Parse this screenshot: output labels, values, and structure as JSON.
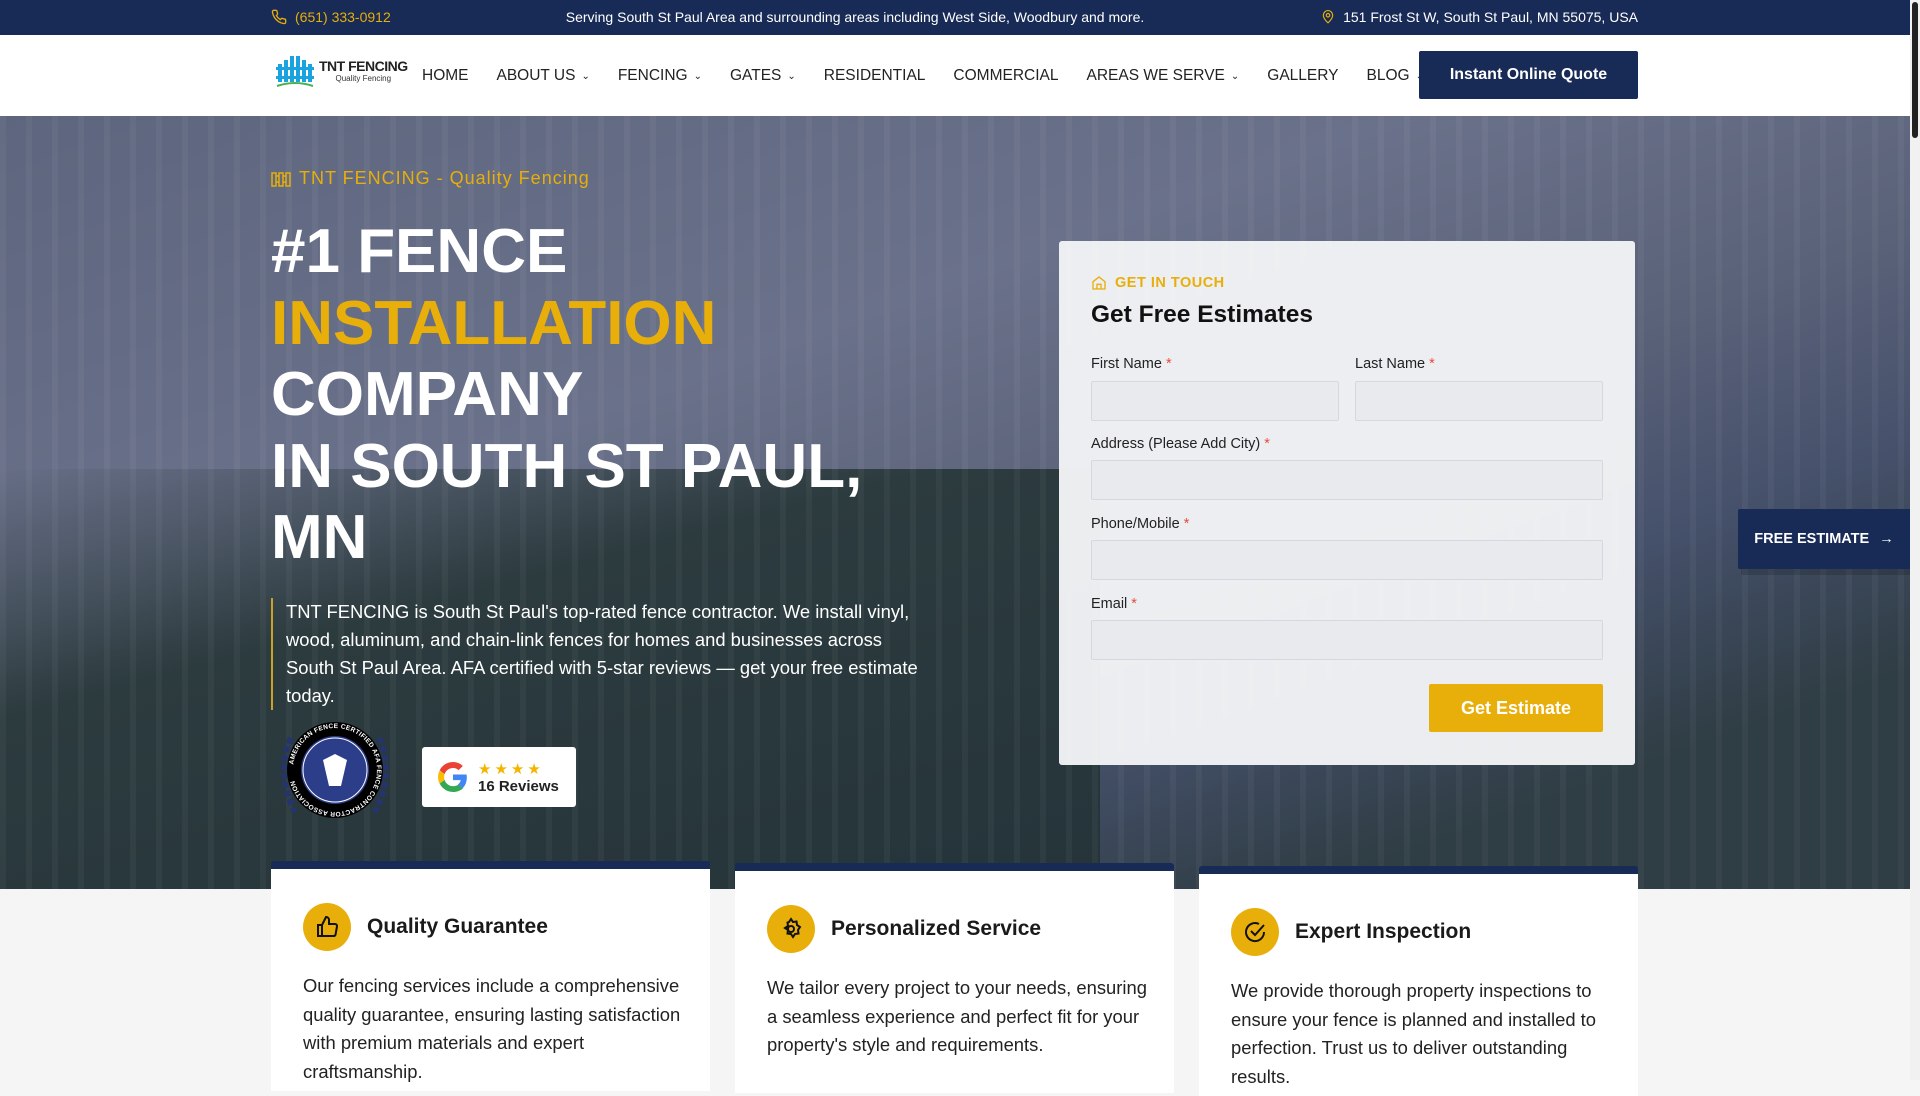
{
  "topbar": {
    "phone": "(651) 333-0912",
    "service_area": "Serving South St Paul Area and surrounding areas including West Side, Woodbury and more.",
    "address": "151 Frost St W, South St Paul, MN 55075, USA"
  },
  "logo": {
    "name": "TNT FENCING",
    "tagline": "Quality Fencing"
  },
  "nav": {
    "items": [
      {
        "label": "HOME",
        "dropdown": false
      },
      {
        "label": "ABOUT US",
        "dropdown": true
      },
      {
        "label": "FENCING",
        "dropdown": true
      },
      {
        "label": "GATES",
        "dropdown": true
      },
      {
        "label": "RESIDENTIAL",
        "dropdown": false
      },
      {
        "label": "COMMERCIAL",
        "dropdown": false
      },
      {
        "label": "AREAS WE SERVE",
        "dropdown": true
      },
      {
        "label": "GALLERY",
        "dropdown": false
      },
      {
        "label": "BLOG",
        "dropdown": true
      }
    ],
    "cta": "Instant Online Quote"
  },
  "hero": {
    "tagline": "TNT FENCING - Quality Fencing",
    "heading_line1": "#1 FENCE",
    "heading_highlight": "INSTALLATION",
    "heading_line3": "COMPANY",
    "heading_line4": "IN SOUTH ST PAUL,",
    "heading_line5": "MN",
    "description": "TNT FENCING is South St Paul's top-rated fence contractor. We install vinyl, wood, aluminum, and chain-link fences for homes and businesses across South St Paul Area. AFA certified with 5-star reviews — get your free estimate today.",
    "badge_text": "AMERICAN FENCE CERTIFIED AFA FENCE CONTRACTOR ASSOCIATION",
    "reviews": {
      "stars": "★★★★",
      "count_label": "16 Reviews"
    }
  },
  "form": {
    "eyebrow": "GET IN TOUCH",
    "title": "Get Free Estimates",
    "fields": {
      "first_name": "First Name",
      "last_name": "Last Name",
      "address": "Address (Please Add City)",
      "phone": "Phone/Mobile",
      "email": "Email"
    },
    "required_mark": "*",
    "submit": "Get Estimate"
  },
  "floating": {
    "free_estimate": "FREE ESTIMATE"
  },
  "features": [
    {
      "title": "Quality Guarantee",
      "body": "Our fencing services include a comprehensive quality guarantee, ensuring lasting satisfaction with premium materials and expert craftsmanship."
    },
    {
      "title": "Personalized Service",
      "body": "We tailor every project to your needs, ensuring a seamless experience and perfect fit for your property's style and requirements."
    },
    {
      "title": "Expert Inspection",
      "body": "We provide thorough property inspections to ensure your fence is planned and installed to perfection. Trust us to deliver outstanding results."
    }
  ],
  "colors": {
    "navy": "#182a56",
    "gold": "#e8ae0a"
  }
}
